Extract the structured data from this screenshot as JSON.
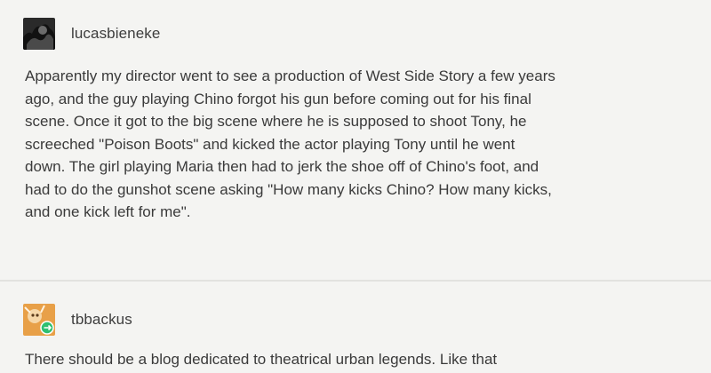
{
  "posts": [
    {
      "username": "lucasbieneke",
      "avatar_icon": "user-avatar-dark",
      "lines": [
        "Apparently my director went to see a production of West Side Story a few years",
        "ago, and the guy playing Chino forgot his gun before coming out for his final",
        "scene. Once it got to the big scene where he is supposed to shoot Tony, he",
        "screeched \"Poison Boots\" and kicked the actor playing Tony until he went",
        "down. The girl playing Maria then had to jerk the shoe off of Chino's foot, and",
        "had to do the gunshot scene asking \"How many kicks Chino? How many kicks,",
        "and one kick left for me\"."
      ]
    },
    {
      "username": "tbbackus",
      "avatar_icon": "user-avatar-orange",
      "lines": [
        "There should be a blog dedicated to theatrical urban legends. Like that"
      ]
    }
  ],
  "colors": {
    "background": "#f4f4f2",
    "text": "#3a3a3a",
    "divider": "#e2e2df",
    "reblog_badge": "#2fbf71"
  }
}
